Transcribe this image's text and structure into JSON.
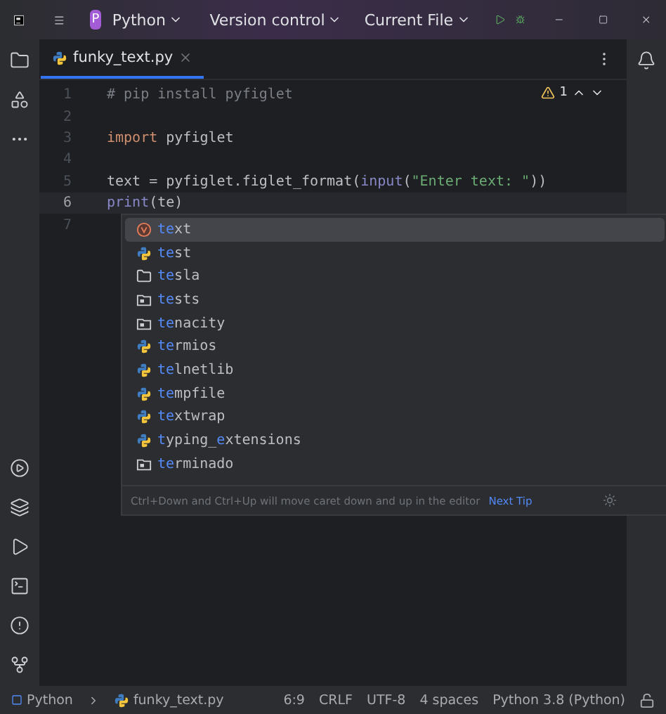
{
  "title_bar": {
    "project_badge": "P",
    "project": "Python",
    "vcs": "Version control",
    "run_config": "Current File"
  },
  "tabs": [
    {
      "label": "funky_text.py",
      "selected": true
    }
  ],
  "inspections": {
    "count": "1"
  },
  "editor": {
    "lines": [
      {
        "number": "1",
        "current": false,
        "tokens": [
          {
            "text": "# pip install pyfiglet",
            "kind": "comment"
          }
        ]
      },
      {
        "number": "2",
        "current": false
      },
      {
        "number": "3",
        "current": false,
        "tokens": [
          {
            "text": "import",
            "kind": "keyword"
          },
          {
            "text": " pyfiglet",
            "kind": "plain"
          }
        ]
      },
      {
        "number": "4",
        "current": false
      },
      {
        "number": "5",
        "current": false,
        "tokens": [
          {
            "text": "text = pyfiglet.figlet_format(",
            "kind": "plain"
          },
          {
            "text": "input",
            "kind": "builtin"
          },
          {
            "text": "(",
            "kind": "plain"
          },
          {
            "text": "\"Enter text: \"",
            "kind": "string"
          },
          {
            "text": "))",
            "kind": "plain"
          }
        ]
      },
      {
        "number": "6",
        "current": true,
        "tokens": [
          {
            "text": "print",
            "kind": "builtin"
          },
          {
            "text": "(te)",
            "kind": "plain"
          }
        ]
      },
      {
        "number": "7",
        "current": false
      }
    ]
  },
  "completion": {
    "items": [
      {
        "kind": "variable",
        "selected": true,
        "parts": [
          {
            "text": "te",
            "match": true
          },
          {
            "text": "xt",
            "match": false
          }
        ]
      },
      {
        "kind": "module",
        "selected": false,
        "parts": [
          {
            "text": "te",
            "match": true
          },
          {
            "text": "st",
            "match": false
          }
        ]
      },
      {
        "kind": "folder",
        "selected": false,
        "parts": [
          {
            "text": "te",
            "match": true
          },
          {
            "text": "sla",
            "match": false
          }
        ]
      },
      {
        "kind": "package",
        "selected": false,
        "parts": [
          {
            "text": "te",
            "match": true
          },
          {
            "text": "sts",
            "match": false
          }
        ]
      },
      {
        "kind": "package",
        "selected": false,
        "parts": [
          {
            "text": "te",
            "match": true
          },
          {
            "text": "nacity",
            "match": false
          }
        ]
      },
      {
        "kind": "module",
        "selected": false,
        "parts": [
          {
            "text": "te",
            "match": true
          },
          {
            "text": "rmios",
            "match": false
          }
        ]
      },
      {
        "kind": "module",
        "selected": false,
        "parts": [
          {
            "text": "te",
            "match": true
          },
          {
            "text": "lnetlib",
            "match": false
          }
        ]
      },
      {
        "kind": "module",
        "selected": false,
        "parts": [
          {
            "text": "te",
            "match": true
          },
          {
            "text": "mpfile",
            "match": false
          }
        ]
      },
      {
        "kind": "module",
        "selected": false,
        "parts": [
          {
            "text": "te",
            "match": true
          },
          {
            "text": "xtwrap",
            "match": false
          }
        ]
      },
      {
        "kind": "module",
        "selected": false,
        "parts": [
          {
            "text": "t",
            "match": true
          },
          {
            "text": "yping_",
            "match": false
          },
          {
            "text": "e",
            "match": true
          },
          {
            "text": "xtensions",
            "match": false
          }
        ]
      },
      {
        "kind": "package",
        "selected": false,
        "parts": [
          {
            "text": "te",
            "match": true
          },
          {
            "text": "rminado",
            "match": false
          }
        ]
      }
    ],
    "tip": "Ctrl+Down and Ctrl+Up will move caret down and up in the editor",
    "tip_link": "Next Tip"
  },
  "status_bar": {
    "project": "Python",
    "file": "funky_text.py",
    "position": "6:9",
    "line_separator": "CRLF",
    "encoding": "UTF-8",
    "indent": "4 spaces",
    "interpreter": "Python 3.8 (Python)"
  }
}
